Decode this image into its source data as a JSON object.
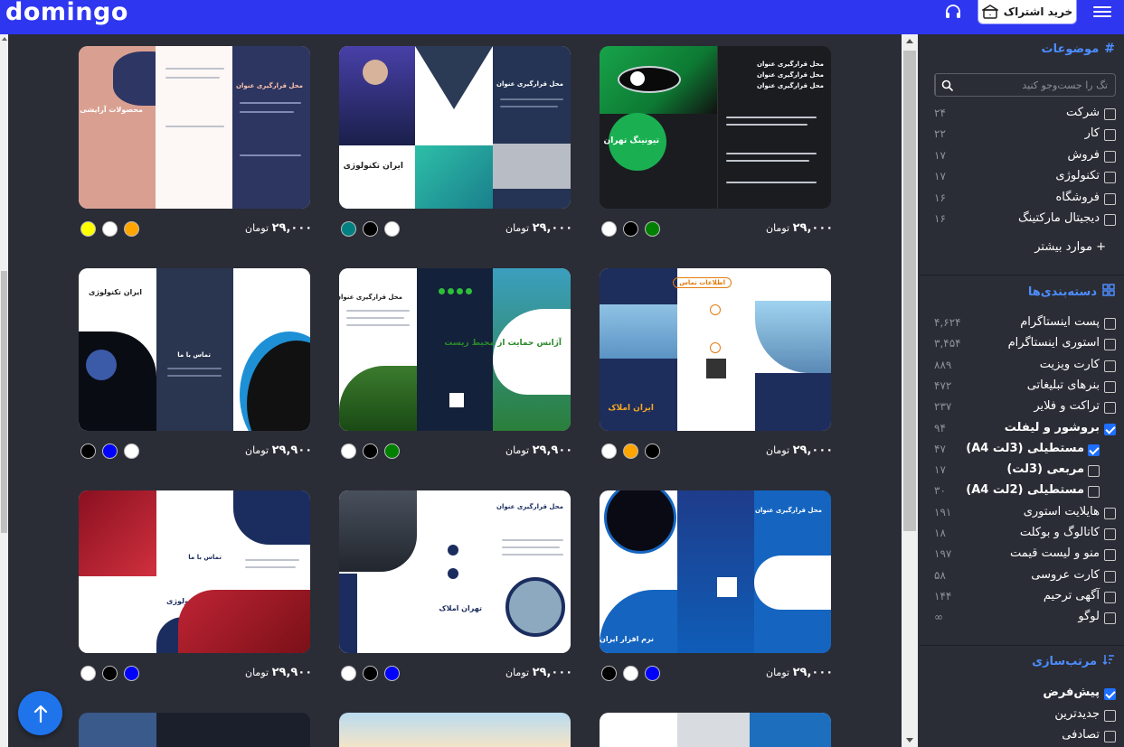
{
  "header": {
    "logo": "domingo",
    "subscribe_label": "خرید اشتراک",
    "support_icon": "headset-icon",
    "menu_icon": "hamburger-icon",
    "bg_color": "#2e36f0"
  },
  "cards": [
    {
      "price": "۲۹,۰۰۰",
      "unit": "تومان",
      "colors": [
        "#008000",
        "#000000",
        "#ffffff"
      ],
      "headline": "محل قرارگیری عنوان",
      "promo": "تیونینگ تهران"
    },
    {
      "price": "۲۹,۰۰۰",
      "unit": "تومان",
      "colors": [
        "#ffffff",
        "#000000",
        "#008080"
      ],
      "headline": "ایران تکنولوژی",
      "promo": "محل قرارگیری عنوان"
    },
    {
      "price": "۲۹,۰۰۰",
      "unit": "تومان",
      "colors": [
        "#ffa500",
        "#ffffff",
        "#ffff00"
      ],
      "headline": "محصولات آرایشی و بهداشتی",
      "promo": "محل قرارگیری عنوان"
    },
    {
      "price": "۲۹,۰۰۰",
      "unit": "تومان",
      "colors": [
        "#000000",
        "#ffa500",
        "#ffffff"
      ],
      "headline": "ایران املاک",
      "promo": "اطلاعات تماس"
    },
    {
      "price": "۲۹,۹۰۰",
      "unit": "تومان",
      "colors": [
        "#008000",
        "#000000",
        "#ffffff"
      ],
      "headline": "آژانس حمایت از محیط زیست",
      "promo": "محل قرارگیری عنوان"
    },
    {
      "price": "۲۹,۹۰۰",
      "unit": "تومان",
      "colors": [
        "#ffffff",
        "#0000ff",
        "#000000"
      ],
      "headline": "ایران تکنولوژی",
      "promo": "تماس با ما"
    },
    {
      "price": "۲۹,۰۰۰",
      "unit": "تومان",
      "colors": [
        "#0000ff",
        "#ffffff",
        "#000000"
      ],
      "headline": "نرم افزار ایران",
      "promo": "محل قرارگیری عنوان"
    },
    {
      "price": "۲۹,۰۰۰",
      "unit": "تومان",
      "colors": [
        "#0000ff",
        "#000000",
        "#ffffff"
      ],
      "headline": "تهران املاک",
      "promo": "محل قرارگیری عنوان"
    },
    {
      "price": "۲۹,۹۰۰",
      "unit": "تومان",
      "colors": [
        "#0000ff",
        "#000000",
        "#ffffff"
      ],
      "headline": "ایران تکنولوژی",
      "promo": "تماس با ما"
    }
  ],
  "sidebar": {
    "topics": {
      "title": "موضوعات",
      "search_placeholder": "تگ را جست‌وجو کنید",
      "items": [
        {
          "label": "شرکت",
          "count": "۲۴"
        },
        {
          "label": "کار",
          "count": "۲۲"
        },
        {
          "label": "فروش",
          "count": "۱۷"
        },
        {
          "label": "تکنولوژی",
          "count": "۱۷"
        },
        {
          "label": "فروشگاه",
          "count": "۱۶"
        },
        {
          "label": "دیجیتال مارکتینگ",
          "count": "۱۶"
        }
      ],
      "more_label": "موارد بیشتر"
    },
    "categories": {
      "title": "دسته‌بندی‌ها",
      "items": [
        {
          "label": "پست اینستاگرام",
          "count": "۴,۶۲۴",
          "checked": false,
          "sub": false
        },
        {
          "label": "استوری اینستاگرام",
          "count": "۳,۴۵۴",
          "checked": false,
          "sub": false
        },
        {
          "label": "کارت ویزیت",
          "count": "۸۸۹",
          "checked": false,
          "sub": false
        },
        {
          "label": "بنرهای تبلیغاتی",
          "count": "۴۷۲",
          "checked": false,
          "sub": false
        },
        {
          "label": "تراکت و فلایر",
          "count": "۲۳۷",
          "checked": false,
          "sub": false
        },
        {
          "label": "بروشور و لیفلت",
          "count": "۹۴",
          "checked": true,
          "sub": false
        },
        {
          "label": "مستطیلی (3لت A4)",
          "count": "۴۷",
          "checked": true,
          "sub": true
        },
        {
          "label": "مربعی (3لت)",
          "count": "۱۷",
          "checked": false,
          "sub": true
        },
        {
          "label": "مستطیلی (2لت A4)",
          "count": "۳۰",
          "checked": false,
          "sub": true
        },
        {
          "label": "هایلایت استوری",
          "count": "۱۹۱",
          "checked": false,
          "sub": false
        },
        {
          "label": "کاتالوگ و بوکلت",
          "count": "۱۸",
          "checked": false,
          "sub": false
        },
        {
          "label": "منو و لیست قیمت",
          "count": "۱۹۷",
          "checked": false,
          "sub": false
        },
        {
          "label": "کارت عروسی",
          "count": "۵۸",
          "checked": false,
          "sub": false
        },
        {
          "label": "آگهی ترحیم",
          "count": "۱۴۴",
          "checked": false,
          "sub": false
        },
        {
          "label": "لوگو",
          "count": "∞",
          "checked": false,
          "sub": false
        }
      ]
    },
    "sort": {
      "title": "مرتب‌سازی",
      "items": [
        {
          "label": "پیش‌فرض",
          "checked": true
        },
        {
          "label": "جدیدترین",
          "checked": false
        },
        {
          "label": "تصادفی",
          "checked": false
        }
      ]
    }
  }
}
